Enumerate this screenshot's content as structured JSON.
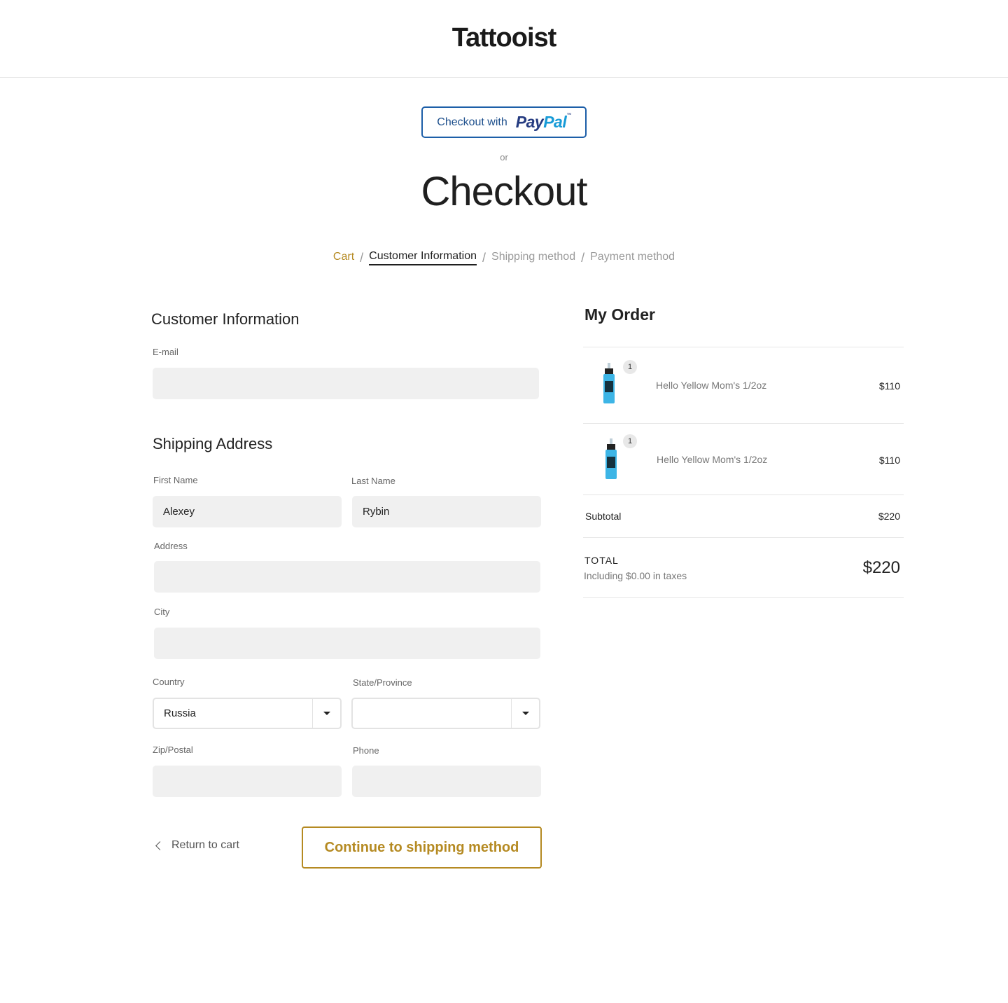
{
  "header": {
    "logo": "Tattooist"
  },
  "paypal": {
    "prefix": "Checkout with",
    "logo_pay": "Pay",
    "logo_pal": "Pal",
    "trademark": "™"
  },
  "or_text": "or",
  "page_title": "Checkout",
  "breadcrumb": {
    "items": [
      {
        "label": "Cart",
        "state": "link"
      },
      {
        "label": "Customer Information",
        "state": "active"
      },
      {
        "label": "Shipping method",
        "state": "upcoming"
      },
      {
        "label": "Payment method",
        "state": "upcoming"
      }
    ],
    "separator": "/"
  },
  "customer_info": {
    "title": "Customer Information",
    "email_label": "E-mail",
    "email_value": ""
  },
  "shipping": {
    "title": "Shipping Address",
    "first_name_label": "First Name",
    "first_name_value": "Alexey",
    "last_name_label": "Last Name",
    "last_name_value": "Rybin",
    "address_label": "Address",
    "address_value": "",
    "city_label": "City",
    "city_value": "",
    "country_label": "Country",
    "country_value": "Russia",
    "state_label": "State/Province",
    "state_value": "",
    "zip_label": "Zip/Postal",
    "zip_value": "",
    "phone_label": "Phone",
    "phone_value": ""
  },
  "actions": {
    "return_label": "Return to cart",
    "continue_label": "Continue to shipping method"
  },
  "order": {
    "title": "My Order",
    "items": [
      {
        "name": "Hello Yellow Mom's 1/2oz",
        "qty": "1",
        "price": "$110"
      },
      {
        "name": "Hello Yellow Mom's 1/2oz",
        "qty": "1",
        "price": "$110"
      }
    ],
    "subtotal_label": "Subtotal",
    "subtotal_value": "$220",
    "total_label": "TOTAL",
    "total_sub": "Including $0.00 in taxes",
    "total_value": "$220"
  },
  "colors": {
    "accent": "#b58a22",
    "paypal_border": "#1d5fa8",
    "input_bg": "#f0f0f0",
    "bottle": "#3db5e6"
  }
}
